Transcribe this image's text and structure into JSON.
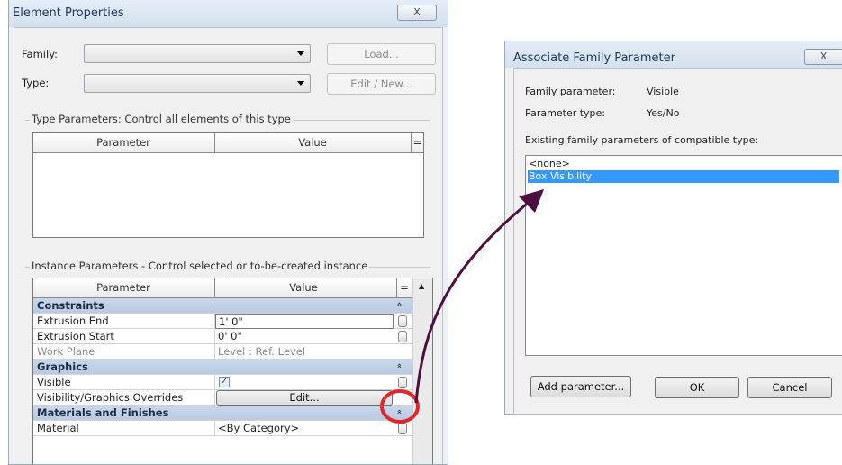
{
  "element_properties": {
    "title": "Element Properties",
    "close_glyph": "X",
    "family_label": "Family:",
    "family_value": "",
    "type_label": "Type:",
    "type_value": "",
    "load_button": "Load...",
    "edit_new_button": "Edit / New...",
    "type_group_title": "Type Parameters: Control all elements of this type",
    "type_grid_headers": [
      "Parameter",
      "Value"
    ],
    "instance_group_title": "Instance Parameters - Control selected or to-be-created instance",
    "instance_grid_headers": [
      "Parameter",
      "Value"
    ],
    "sections": [
      {
        "name": "Constraints",
        "collapse_glyph": "»",
        "rows": [
          {
            "parameter": "Extrusion End",
            "value": "1'  0\""
          },
          {
            "parameter": "Extrusion Start",
            "value": "0'  0\""
          },
          {
            "parameter": "Work Plane",
            "value": "Level : Ref. Level",
            "disabled": true
          }
        ]
      },
      {
        "name": "Graphics",
        "collapse_glyph": "»",
        "rows": [
          {
            "parameter": "Visible",
            "value": "✓",
            "type": "checkbox",
            "checked": true
          },
          {
            "parameter": "Visibility/Graphics Overrides",
            "value": "Edit...",
            "type": "button"
          }
        ]
      },
      {
        "name": "Materials and Finishes",
        "collapse_glyph": "»",
        "rows": [
          {
            "parameter": "Material",
            "value": "<By Category>"
          }
        ]
      }
    ]
  },
  "associate_family_parameter": {
    "title": "Associate Family Parameter",
    "close_glyph": "X",
    "family_parameter_label": "Family parameter:",
    "family_parameter_value": "Visible",
    "parameter_type_label": "Parameter type:",
    "parameter_type_value": "Yes/No",
    "existing_label": "Existing family parameters of compatible type:",
    "list_items": [
      {
        "label": "<none>",
        "selected": false
      },
      {
        "label": "Box Visibility",
        "selected": true
      }
    ],
    "add_parameter_button": "Add parameter...",
    "ok_button": "OK",
    "cancel_button": "Cancel"
  },
  "annotation": {
    "arrow_color": "#4b1040",
    "highlight_circle_color": "#e0262b"
  }
}
